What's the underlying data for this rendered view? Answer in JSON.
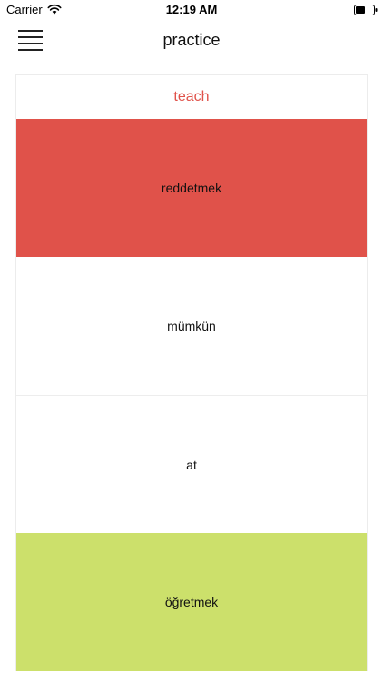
{
  "status_bar": {
    "carrier": "Carrier",
    "time": "12:19 AM",
    "wifi_icon": "wifi-icon",
    "battery_icon": "battery-icon"
  },
  "nav": {
    "menu_icon": "hamburger-menu-icon",
    "title": "practice"
  },
  "practice": {
    "prompt_word": "teach",
    "prompt_color": "#e0524a",
    "options": [
      {
        "label": "reddetmek",
        "state": "incorrect",
        "background": "#e0524a"
      },
      {
        "label": "mümkün",
        "state": "neutral",
        "background": "#ffffff"
      },
      {
        "label": "at",
        "state": "neutral",
        "background": "#ffffff"
      },
      {
        "label": "öğretmek",
        "state": "correct",
        "background": "#cce06b"
      }
    ]
  }
}
